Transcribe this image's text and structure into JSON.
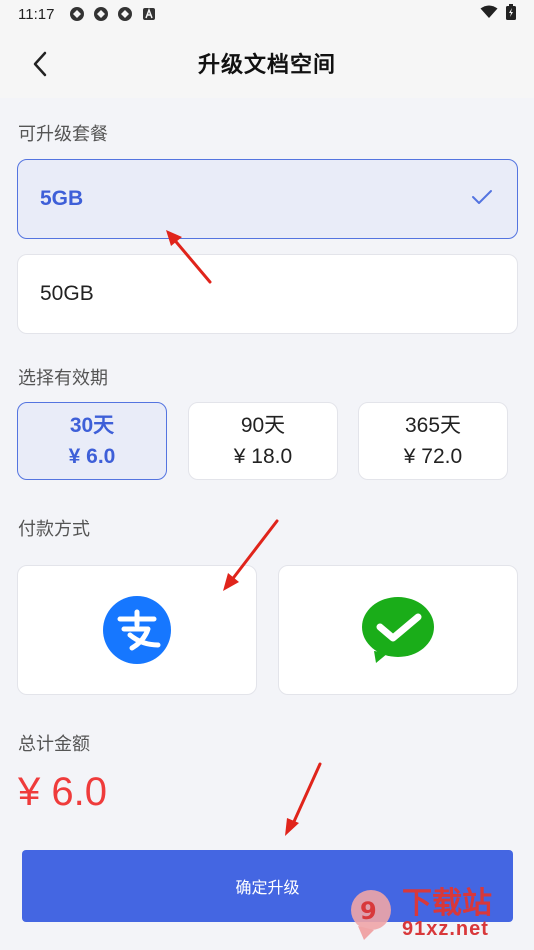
{
  "status_bar": {
    "time": "11:17",
    "icons": [
      "sync-icon",
      "sync-icon",
      "sync-icon",
      "accessibility-a-icon"
    ],
    "right_icons": [
      "wifi-icon",
      "battery-icon"
    ]
  },
  "header": {
    "title": "升级文档空间",
    "back_icon": "chevron-left-icon"
  },
  "plans": {
    "label": "可升级套餐",
    "items": [
      {
        "name": "5GB",
        "selected": true
      },
      {
        "name": "50GB",
        "selected": false
      }
    ]
  },
  "validity": {
    "label": "选择有效期",
    "items": [
      {
        "duration": "30天",
        "price": "¥ 6.0",
        "selected": true
      },
      {
        "duration": "90天",
        "price": "¥ 18.0",
        "selected": false
      },
      {
        "duration": "365天",
        "price": "¥ 72.0",
        "selected": false
      }
    ]
  },
  "payment": {
    "label": "付款方式",
    "methods": [
      {
        "icon": "alipay-icon",
        "color": "#1677ff"
      },
      {
        "icon": "wechat-pay-icon",
        "color": "#1aad19"
      }
    ]
  },
  "total": {
    "label": "总计金额",
    "amount": "¥ 6.0"
  },
  "confirm": {
    "label": "确定升级"
  },
  "watermark": {
    "top": "下载站",
    "bottom": "91xz.net"
  },
  "colors": {
    "accent": "#4466e2",
    "selected_bg": "#e9ecf8",
    "price_red": "#ef3b3b",
    "annotation_red": "#e0241b"
  }
}
